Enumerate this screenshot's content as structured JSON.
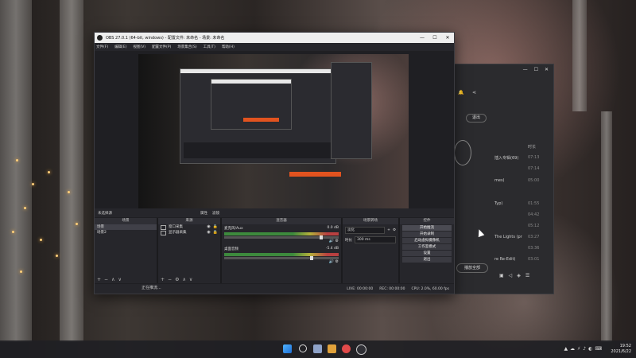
{
  "obs": {
    "title": "OBS 27.0.1 (64-bit, windows) - 配置文件: 未命名 - 场景: 未命名",
    "menu": [
      "文件(F)",
      "编辑(E)",
      "视图(V)",
      "配置文件(P)",
      "场景集合(S)",
      "工具(T)",
      "帮助(H)"
    ],
    "status_strip": {
      "left": "未选择源",
      "props": "属性",
      "filters": "滤镜"
    },
    "scenes": {
      "header": "场景",
      "items": [
        "场景",
        "场景2"
      ],
      "selected_index": 0
    },
    "sources": {
      "header": "来源",
      "items": [
        "窗口采集",
        "显示器采集"
      ]
    },
    "mixer": {
      "header": "混音器",
      "channels": [
        {
          "name": "麦克风/Aux",
          "db": "0.0 dB"
        },
        {
          "name": "桌面音频",
          "db": "-5.4 dB"
        }
      ]
    },
    "transitions": {
      "header": "场景转场",
      "type": "淡化",
      "duration_label": "时长",
      "duration": "300 ms"
    },
    "controls": {
      "header": "控件",
      "buttons": [
        "开始推流",
        "开始录制",
        "启动虚拟摄像机",
        "工作室模式",
        "设置",
        "退出"
      ]
    },
    "bottom": {
      "live": "LIVE: 00:00:00",
      "rec": "REC: 00:00:00",
      "cpu": "CPU: 2.0%, 60.00 fps"
    },
    "status_msg": "正在推流..."
  },
  "music": {
    "logout": "退出",
    "items": [
      {
        "title": "插入专辑(69)",
        "time": "07:13"
      },
      {
        "title": "",
        "time": "07:14"
      },
      {
        "title": "mes)",
        "time": "05:00"
      },
      {
        "title": "Typ)",
        "time": "01:55"
      },
      {
        "title": "",
        "time": "04:42"
      },
      {
        "title": "",
        "time": "05:12"
      },
      {
        "title": "The Lights (pr",
        "time": "03:27"
      },
      {
        "title": "",
        "time": "03:36"
      },
      {
        "title": "re Re-Edit)",
        "time": "03:01"
      }
    ],
    "time_header": "时长",
    "bottom_button": "播放全部"
  },
  "taskbar": {
    "clock_time": "19:52",
    "clock_date": "2021/6/22"
  },
  "colors": {
    "accent": "#e2531f",
    "obs_bg": "#1f1f23"
  }
}
